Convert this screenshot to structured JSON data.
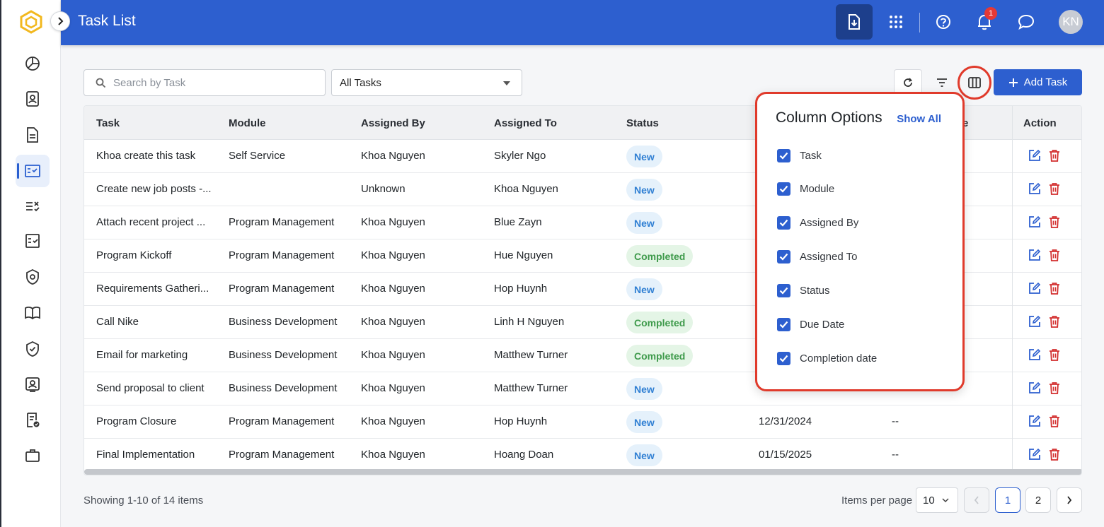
{
  "header": {
    "title": "Task List",
    "notification_count": "1",
    "avatar_initials": "KN",
    "icons": [
      "export-icon",
      "apps-grid-icon",
      "help-icon",
      "bell-icon",
      "chat-icon"
    ]
  },
  "sidebar": {
    "items": [
      {
        "name": "dashboard-icon"
      },
      {
        "name": "contacts-icon"
      },
      {
        "name": "document-icon"
      },
      {
        "name": "task-list-icon",
        "active": true
      },
      {
        "name": "checklist-icon"
      },
      {
        "name": "approval-icon"
      },
      {
        "name": "security-icon"
      },
      {
        "name": "book-icon"
      },
      {
        "name": "shield-icon"
      },
      {
        "name": "profile-icon"
      },
      {
        "name": "certificate-icon"
      },
      {
        "name": "briefcase-icon"
      }
    ]
  },
  "toolbar": {
    "search_placeholder": "Search by Task",
    "filter_value": "All Tasks",
    "add_label": "Add Task"
  },
  "table": {
    "columns": [
      "Task",
      "Module",
      "Assigned By",
      "Assigned To",
      "Status",
      "Action"
    ],
    "hidden_header_fragment": "e",
    "rows": [
      {
        "task": "Khoa create this task",
        "module": "Self Service",
        "by": "Khoa Nguyen",
        "to": "Skyler Ngo",
        "status": "New",
        "due": "",
        "completion": ""
      },
      {
        "task": "Create new job posts -...",
        "module": "",
        "by": "Unknown",
        "to": "Khoa Nguyen",
        "status": "New",
        "due": "",
        "completion": ""
      },
      {
        "task": "Attach recent project ...",
        "module": "Program Management",
        "by": "Khoa Nguyen",
        "to": "Blue Zayn",
        "status": "New",
        "due": "",
        "completion": ""
      },
      {
        "task": "Program Kickoff",
        "module": "Program Management",
        "by": "Khoa Nguyen",
        "to": "Hue Nguyen",
        "status": "Completed",
        "due": "",
        "completion": ""
      },
      {
        "task": "Requirements Gatheri...",
        "module": "Program Management",
        "by": "Khoa Nguyen",
        "to": "Hop Huynh",
        "status": "New",
        "due": "",
        "completion": ""
      },
      {
        "task": "Call Nike",
        "module": "Business Development",
        "by": "Khoa Nguyen",
        "to": "Linh H Nguyen",
        "status": "Completed",
        "due": "",
        "completion": ""
      },
      {
        "task": "Email for marketing",
        "module": "Business Development",
        "by": "Khoa Nguyen",
        "to": "Matthew Turner",
        "status": "Completed",
        "due": "",
        "completion": ""
      },
      {
        "task": "Send proposal to client",
        "module": "Business Development",
        "by": "Khoa Nguyen",
        "to": "Matthew Turner",
        "status": "New",
        "due": "",
        "completion": ""
      },
      {
        "task": "Program Closure",
        "module": "Program Management",
        "by": "Khoa Nguyen",
        "to": "Hop Huynh",
        "status": "New",
        "due": "12/31/2024",
        "completion": "--"
      },
      {
        "task": "Final Implementation",
        "module": "Program Management",
        "by": "Khoa Nguyen",
        "to": "Hoang Doan",
        "status": "New",
        "due": "01/15/2025",
        "completion": "--"
      }
    ]
  },
  "column_options": {
    "title": "Column Options",
    "show_all": "Show All",
    "options": [
      {
        "label": "Task",
        "checked": true
      },
      {
        "label": "Module",
        "checked": true
      },
      {
        "label": "Assigned By",
        "checked": true
      },
      {
        "label": "Assigned To",
        "checked": true
      },
      {
        "label": "Status",
        "checked": true
      },
      {
        "label": "Due Date",
        "checked": true
      },
      {
        "label": "Completion date",
        "checked": true
      }
    ]
  },
  "footer": {
    "showing": "Showing 1-10 of 14 items",
    "items_per_page_label": "Items per page",
    "items_per_page_value": "10",
    "pages": [
      "1",
      "2"
    ],
    "current_page": "1"
  },
  "colors": {
    "brand": "#2d5fcf",
    "highlight": "#e03a2b",
    "status_new": "#2f7fd3",
    "status_completed": "#3e9a4b",
    "delete": "#d32f2f"
  }
}
